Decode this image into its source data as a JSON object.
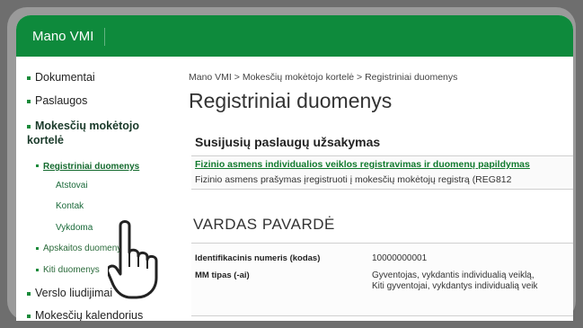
{
  "header": {
    "brand": "Mano VMI"
  },
  "sidebar": {
    "items": [
      {
        "label": "Dokumentai"
      },
      {
        "label": "Paslaugos"
      },
      {
        "label": "Mokesčių mokėtojo kortelė"
      },
      {
        "label": "Registriniai duomenys"
      },
      {
        "label": "Atstovai"
      },
      {
        "label": "Kontak"
      },
      {
        "label": "Vykdoma"
      },
      {
        "label": "Apskaitos duomenys"
      },
      {
        "label": "Kiti duomenys"
      },
      {
        "label": "Verslo liudijimai"
      },
      {
        "label": "Mokesčių kalendorius"
      }
    ]
  },
  "main": {
    "breadcrumb": "Mano VMI > Mokesčių mokėtojo kortelė > Registriniai duomenys",
    "title": "Registriniai duomenys",
    "section_title": "Susijusių paslaugų užsakymas",
    "service_link": "Fizinio asmens individualios veiklos registravimas ir duomenų papildymas",
    "service_desc": "Fizinio asmens prašymas įregistruoti į mokesčių mokėtojų registrą (REG812",
    "person_name": "VARDAS PAVARDĖ",
    "id_label": "Identifikacinis numeris (kodas)",
    "id_value": "10000000001",
    "mm_label": "MM tipas (-ai)",
    "mm_value_1": "Gyventojas, vykdantis individualią veiklą,",
    "mm_value_2": "Kiti gyventojai, vykdantys individualią veik"
  }
}
